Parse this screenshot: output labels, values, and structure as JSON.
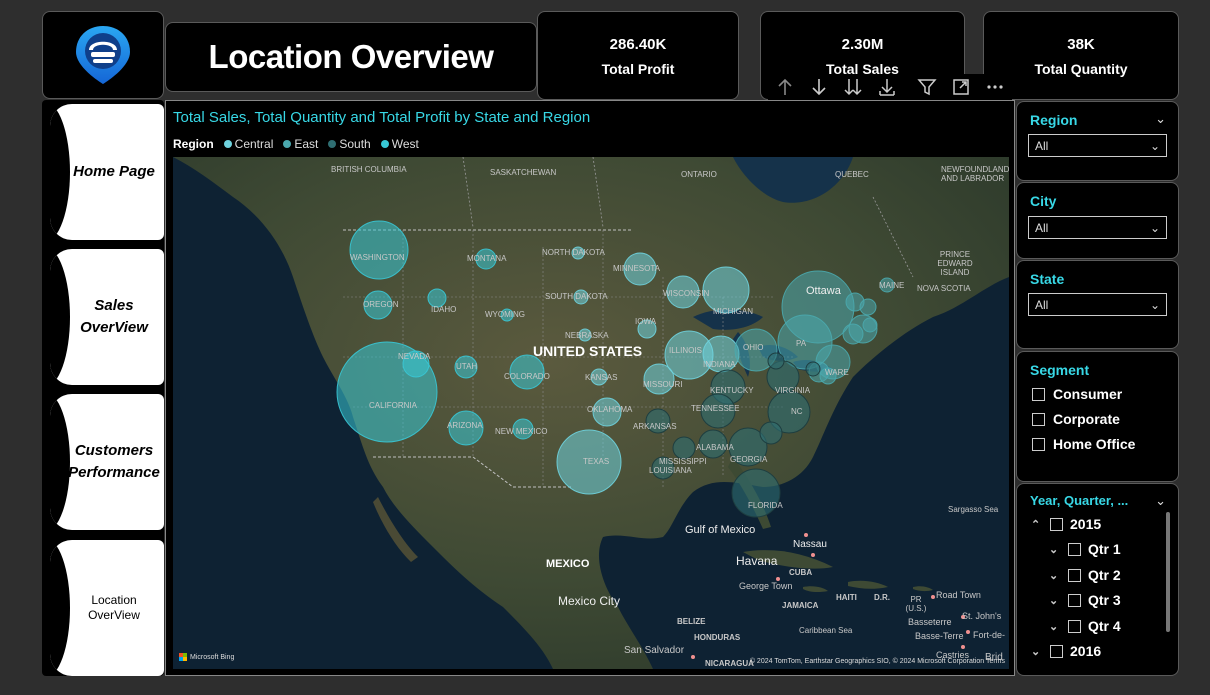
{
  "header": {
    "title": "Location Overview"
  },
  "kpis": [
    {
      "value": "286.40K",
      "label": "Total Profit"
    },
    {
      "value": "2.30M",
      "label": "Total Sales"
    },
    {
      "value": "38K",
      "label": "Total Quantity"
    }
  ],
  "nav": {
    "home": "Home Page",
    "sales": "Sales OverView",
    "customer": "Customers Performance",
    "location": "Location OverView"
  },
  "map": {
    "title": "Total Sales, Total Quantity and Total Profit by State and Region",
    "legend_title": "Region",
    "legend": [
      {
        "name": "Central",
        "color": "#6fd3de"
      },
      {
        "name": "East",
        "color": "#4aa8ad"
      },
      {
        "name": "South",
        "color": "#2f6e72"
      },
      {
        "name": "West",
        "color": "#38c8d6"
      }
    ],
    "country_label": "UNITED STATES",
    "attribution": "Microsoft Bing",
    "copyright": "© 2024 TomTom, Earthstar Geographics SIO, © 2024 Microsoft Corporation  Terms",
    "labels": {
      "bc": "BRITISH COLUMBIA",
      "sask": "SASKATCHEWAN",
      "ontario": "ONTARIO",
      "quebec": "QUEBEC",
      "nfl": "NEWFOUNDLAND AND LABRADOR",
      "pei": "PRINCE EDWARD ISLAND",
      "ns": "NOVA SCOTIA",
      "wa": "WASHINGTON",
      "or": "OREGON",
      "ca": "CALIFORNIA",
      "nv": "NEVADA",
      "id": "IDAHO",
      "mt": "MONTANA",
      "wy": "WYOMING",
      "ut": "UTAH",
      "az": "ARIZONA",
      "co": "COLORADO",
      "nm": "NEW MEXICO",
      "nd": "NORTH DAKOTA",
      "sd": "SOUTH DAKOTA",
      "ne": "NEBRASKA",
      "ks": "KANSAS",
      "ok": "OKLAHOMA",
      "tx": "TEXAS",
      "mn": "MINNESOTA",
      "ia": "IOWA",
      "mo": "MISSOURI",
      "ar": "ARKANSAS",
      "ms": "MISSISSIPPI",
      "la": "LOUISIANA",
      "wi": "WISCONSIN",
      "il": "ILLINOIS",
      "in": "INDIANA",
      "mi": "MICHIGAN",
      "oh": "OHIO",
      "ky": "KENTUCKY",
      "tn": "TENNESSEE",
      "al": "ALABAMA",
      "ga": "GEORGIA",
      "fl": "FLORIDA",
      "nc": "NC",
      "va": "VIRGINIA",
      "pa": "PA",
      "ottawa": "Ottawa",
      "maine": "MAINE",
      "ware": "WARE",
      "gulf": "Gulf of Mexico",
      "mexico": "MEXICO",
      "mexcity": "Mexico City",
      "havana": "Havana",
      "cuba": "CUBA",
      "nassau": "Nassau",
      "georgetown": "George Town",
      "jamaica": "JAMAICA",
      "haiti": "HAITI",
      "dr": "D.R.",
      "pr": "PR (U.S.)",
      "roadtown": "Road Town",
      "stjohns": "St. John's",
      "basseterre": "Basseterre",
      "bt": "Basse-Terre",
      "fdf": "Fort-de-",
      "castries": "Castries",
      "brid": "Brid",
      "sargasso": "Sargasso Sea",
      "caribbean": "Caribbean Sea",
      "belize": "BELIZE",
      "honduras": "HONDURAS",
      "sansalvador": "San Salvador",
      "nicaragua": "NICARAGUA"
    }
  },
  "slicers": {
    "region": {
      "title": "Region",
      "value": "All"
    },
    "city": {
      "title": "City",
      "value": "All"
    },
    "state": {
      "title": "State",
      "value": "All"
    },
    "segment": {
      "title": "Segment",
      "options": [
        "Consumer",
        "Corporate",
        "Home Office"
      ]
    },
    "date": {
      "title": "Year, Quarter, ...",
      "year1": "2015",
      "quarters": [
        "Qtr 1",
        "Qtr 2",
        "Qtr 3",
        "Qtr 4"
      ],
      "year2": "2016"
    }
  },
  "icons": {
    "toolbar": [
      "arrow-up-icon",
      "arrow-down-icon",
      "double-arrow-down-icon",
      "expand-down-icon",
      "filter-icon",
      "focus-mode-icon",
      "more-options-icon"
    ],
    "logo": "location-pin-logo-icon"
  }
}
